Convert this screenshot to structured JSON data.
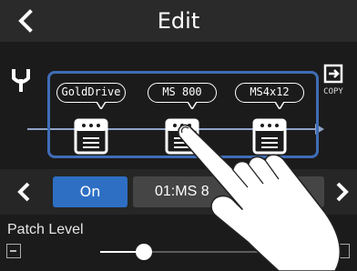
{
  "header": {
    "title": "Edit",
    "back_icon": "chevron-left-icon"
  },
  "chain": {
    "input_icon": "input-jack-icon",
    "copy": {
      "label": "COPY",
      "icon": "copy-icon"
    },
    "effects": [
      {
        "name": "GoldDrive",
        "icon": "pedal-icon"
      },
      {
        "name": "MS 800",
        "icon": "pedal-icon"
      },
      {
        "name": "MS4x12",
        "icon": "pedal-icon"
      }
    ],
    "selected_index": 1,
    "accent": "#3f6db6"
  },
  "nav": {
    "prev_icon": "chevron-left-icon",
    "next_icon": "chevron-right-icon",
    "on_label": "On",
    "slot_label": "01:MS 8",
    "on_color": "#2e6fc4"
  },
  "param": {
    "label": "Patch Level",
    "minus_icon": "minus-icon",
    "plus_icon": "plus-icon",
    "level_fraction": 0.2
  },
  "overlay": {
    "icon": "pointing-hand-icon"
  }
}
